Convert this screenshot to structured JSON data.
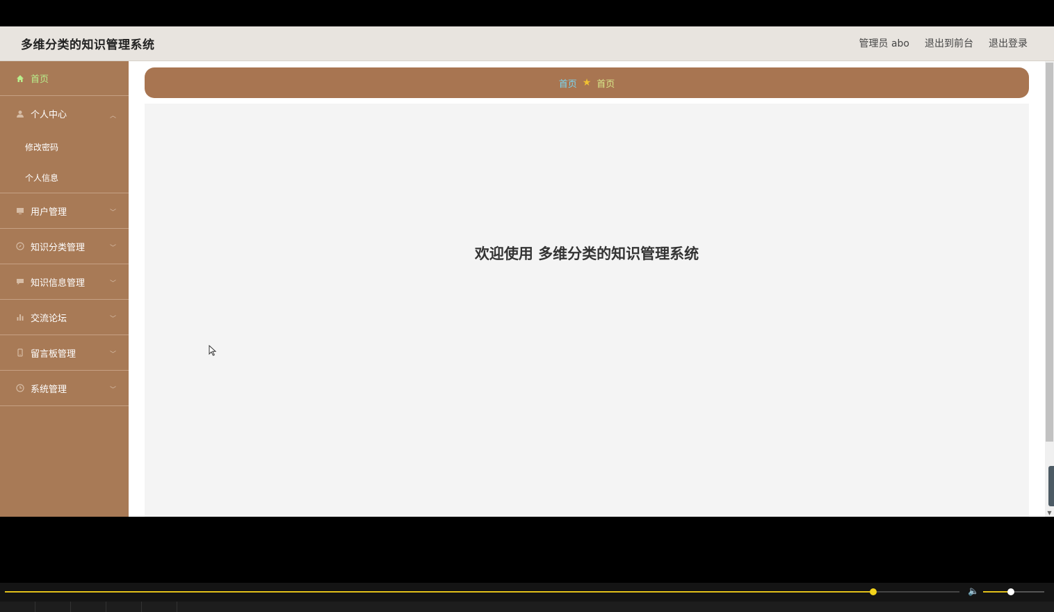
{
  "header": {
    "title": "多维分类的知识管理系统",
    "user_label": "管理员 abo",
    "to_frontend": "退出到前台",
    "logout": "退出登录"
  },
  "sidebar": {
    "home": "首页",
    "personal_center": "个人中心",
    "personal_sub": [
      "修改密码",
      "个人信息"
    ],
    "items": [
      "用户管理",
      "知识分类管理",
      "知识信息管理",
      "交流论坛",
      "留言板管理",
      "系统管理"
    ]
  },
  "breadcrumb": {
    "root": "首页",
    "current": "首页"
  },
  "main": {
    "welcome": "欢迎使用 多维分类的知识管理系统"
  },
  "player": {
    "progress": 0.91,
    "volume": 0.45
  },
  "colors": {
    "sidebar": "#a87a56",
    "breadcrumb_bar": "#a87551",
    "home_active": "#b9ef8c",
    "accent": "#e3c21a"
  }
}
